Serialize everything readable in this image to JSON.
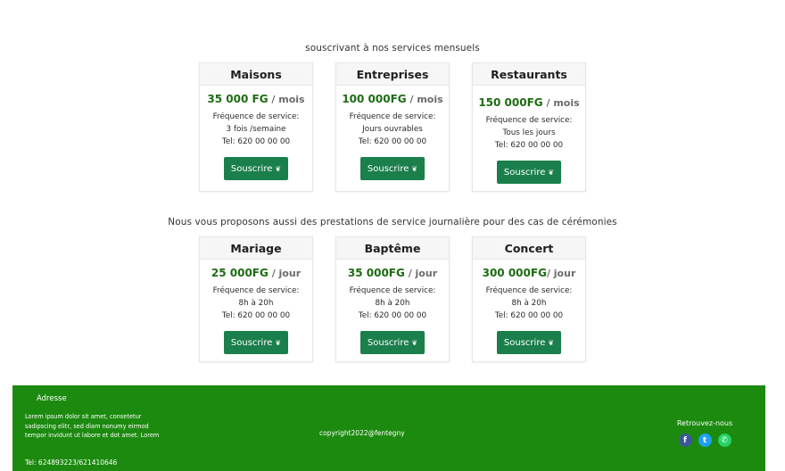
{
  "monthly": {
    "heading": "souscrivant à nos services mensuels",
    "cards": [
      {
        "title": "Maisons",
        "price": "35 000 FG",
        "unit": " / mois",
        "freq_label": "Fréquence de service:",
        "freq": "3 fois /semaine",
        "tel": "Tel: 620 00 00 00",
        "button": "Souscrire"
      },
      {
        "title": "Entreprises",
        "price": "100 000FG",
        "unit": " / mois",
        "freq_label": "Fréquence de service:",
        "freq": "Jours ouvrables",
        "tel": "Tel: 620 00 00 00",
        "button": "Souscrire"
      },
      {
        "title": "Restaurants",
        "price": "150 000FG",
        "unit": " / mois",
        "freq_label": "Fréquence de service:",
        "freq": "Tous les jours",
        "tel": "Tel: 620 00 00 00",
        "button": "Souscrire"
      }
    ]
  },
  "daily": {
    "heading": "Nous vous proposons aussi des prestations de service journalière pour des cas de cérémonies",
    "cards": [
      {
        "title": "Mariage",
        "price": "25 000FG",
        "unit": " / jour",
        "freq_label": "Fréquence de service:",
        "freq": "8h à 20h",
        "tel": "Tel: 620 00 00 00",
        "button": "Souscrire"
      },
      {
        "title": "Baptême",
        "price": "35 000FG",
        "unit": " / jour",
        "freq_label": "Fréquence de service:",
        "freq": "8h à 20h",
        "tel": "Tel: 620 00 00 00",
        "button": "Souscrire"
      },
      {
        "title": "Concert",
        "price": "300 000FG",
        "unit": "/ jour",
        "freq_label": "Fréquence de service:",
        "freq": "8h à 20h",
        "tel": "Tel: 620 00 00 00",
        "button": "Souscrire"
      }
    ]
  },
  "footer": {
    "address_title": "Adresse",
    "address_text": "Lorem ipsum dolor sit amet, consetetur sadipscing elitr, sed diam nonumy eirmod tempor invidunt ut labore et dot amet. Lorem",
    "tel": "Tel: 624893223/621410646",
    "copyright": "copyright2022@fentegny",
    "social_label": "Retrouvez-nous",
    "socials": [
      "facebook-icon",
      "twitter-icon",
      "whatsapp-icon"
    ]
  },
  "colors": {
    "price_green": "#1c6b11",
    "button_green": "#1a7f4b",
    "footer_green": "#1c8a0f"
  }
}
